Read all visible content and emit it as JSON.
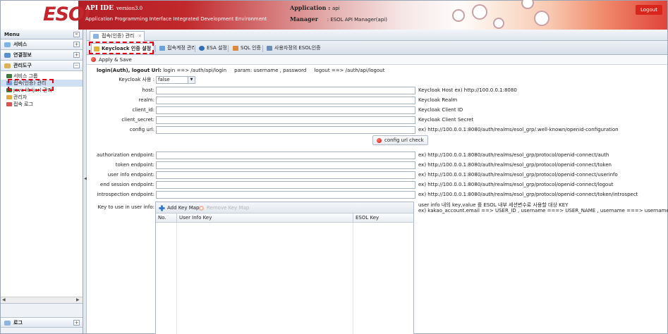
{
  "header": {
    "logo": "ESOL",
    "api_title": "API IDE",
    "api_version": "version3.0",
    "api_subtitle": "Application Programming Interface Integrated Development Environment",
    "app_label": "Application :",
    "app_value": "api",
    "manager_label": "Manager",
    "manager_value": ": ESOL API Manager(api)",
    "logout_label": "Logout"
  },
  "sidebar": {
    "title": "Menu",
    "collapse_glyph": "«",
    "sections": [
      {
        "label": "서비스",
        "toggle": "+"
      },
      {
        "label": "연결정보",
        "toggle": "+"
      },
      {
        "label": "관리도구",
        "toggle": "−"
      }
    ],
    "tree": [
      {
        "label": "서비스 그룹"
      },
      {
        "label": "접속(인증) 관리"
      },
      {
        "label": "java lib(jar) 관리"
      },
      {
        "label": "관리자"
      },
      {
        "label": "접속 로그"
      }
    ],
    "bottom_section": {
      "label": "로그",
      "toggle": "+"
    }
  },
  "main": {
    "page_tab": {
      "label": "접속(인증) 관리",
      "close": "×"
    },
    "sub_tabs": [
      {
        "label": "Keycloack 인증 설정",
        "active": true
      },
      {
        "label": "접속계정 관리"
      },
      {
        "label": "ESA 설정"
      },
      {
        "label": "SQL 인증"
      },
      {
        "label": "사용자정의 ESOL인증"
      }
    ],
    "apply_label": "Apply & Save",
    "info": {
      "bold": "login(Auth), logout Url:",
      "text": " login ==> /auth/api/login     param: username , password     logout ==> /auth/api/logout"
    },
    "keycloak_use": {
      "label": "Keycloak 사용 :",
      "value": "false"
    },
    "fields": [
      {
        "label": "host:",
        "value": "",
        "hint": "Keycloak Host ex) http://100.0.0.1:8080"
      },
      {
        "label": "realm:",
        "value": "",
        "hint": "Keycloak Realm"
      },
      {
        "label": "client_id:",
        "value": "",
        "hint": "Keycloak Client ID"
      },
      {
        "label": "client_secret:",
        "value": "",
        "hint": "Keycloak Client Secret"
      },
      {
        "label": "config url:",
        "value": "",
        "hint": "ex) http://100.0.0.1:8080/auth/realms/esol_grp/.well-known/openid-configuration"
      }
    ],
    "config_check_label": "config url check",
    "endpoints": [
      {
        "label": "authorization endpoint:",
        "value": "",
        "hint": "ex) http://100.0.0.1:8080/auth/realms/esol_grp/protocol/openid-connect/auth"
      },
      {
        "label": "token endpoint:",
        "value": "",
        "hint": "ex) http://100.0.0.1:8080/auth/realms/esol_grp/protocol/openid-connect/token"
      },
      {
        "label": "user info endpoint:",
        "value": "",
        "hint": "ex) http://100.0.0.1:8080/auth/realms/esol_grp/protocol/openid-connect/userinfo"
      },
      {
        "label": "end session endpoint:",
        "value": "",
        "hint": "ex) http://100.0.0.1:8080/auth/realms/esol_grp/protocol/openid-connect/logout"
      },
      {
        "label": "introspection endpoint:",
        "value": "",
        "hint": "ex) http://100.0.0.1:8080/auth/realms/esol_grp/protocol/openid-connect/token/introspect"
      }
    ],
    "key_map": {
      "label": "Key to use in user info:",
      "add_label": "Add Key Map",
      "remove_label": "Remove Key Map",
      "columns": [
        "No.",
        "User Info Key",
        "ESOL Key"
      ],
      "hint_line1": "user info 내의 key,value 를 ESOL 내부 세션변수로 사용할 대상 KEY",
      "hint_line2": "ex) kakao_account.email ==> USER_ID , username ===> USER_NAME , username ===> username"
    }
  },
  "colors": {
    "brand_red": "#c1272d",
    "highlight_dashed": "#e60012",
    "panel_border": "#aab6c6"
  }
}
